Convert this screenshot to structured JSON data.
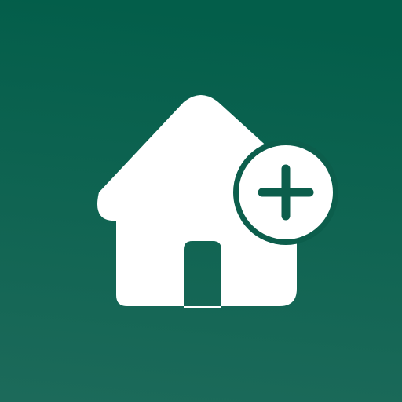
{
  "icon": {
    "name": "add-home-icon",
    "badge_icon": "plus-icon",
    "colors": {
      "background_top": "#035e4a",
      "background_bottom": "#1c6a5a",
      "glyph": "#ffffff",
      "accent": "#0c5e4c"
    }
  }
}
